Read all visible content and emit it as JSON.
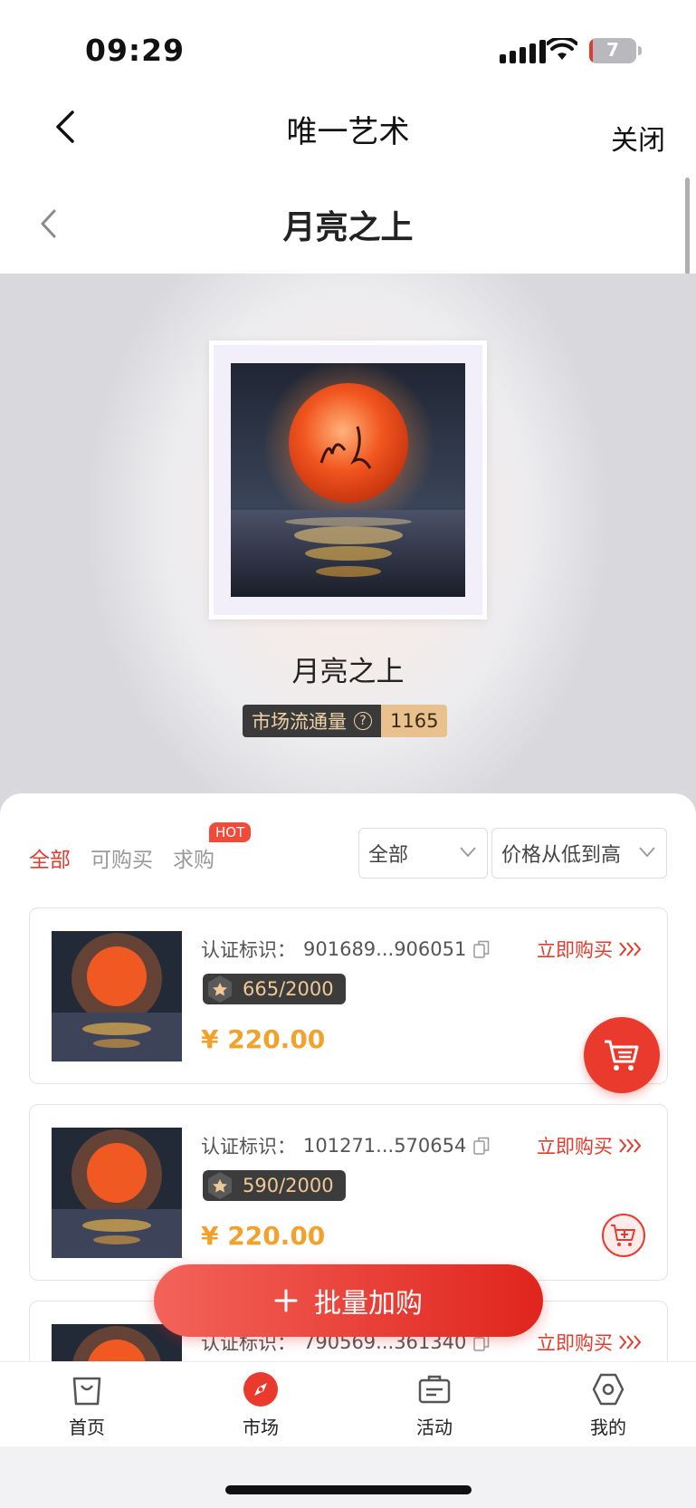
{
  "status_bar": {
    "time": "09:29",
    "battery": "7"
  },
  "app_header": {
    "title": "唯一艺术",
    "close_label": "关闭"
  },
  "page_header": {
    "title": "月亮之上"
  },
  "hero": {
    "title": "月亮之上",
    "circulation_label": "市场流通量",
    "circulation_value": "1165"
  },
  "filters": {
    "tabs": [
      {
        "label": "全部",
        "active": true
      },
      {
        "label": "可购买",
        "active": false
      },
      {
        "label": "求购",
        "active": false
      }
    ],
    "hot_badge": "HOT",
    "dropdown_category": "全部",
    "dropdown_sort": "价格从低到高"
  },
  "listings": [
    {
      "cert_label": "认证标识：",
      "cert_id": "901689...906051",
      "buy_label": "立即购买",
      "serial": "665/2000",
      "price": "¥ 220.00"
    },
    {
      "cert_label": "认证标识：",
      "cert_id": "101271...570654",
      "buy_label": "立即购买",
      "serial": "590/2000",
      "price": "¥ 220.00"
    },
    {
      "cert_label": "认证标识：",
      "cert_id": "790569...361340",
      "buy_label": "立即购买",
      "serial": "",
      "price": ""
    }
  ],
  "bulk_button": {
    "label": "批量加购"
  },
  "tabbar": {
    "items": [
      {
        "label": "首页",
        "icon": "shopping-bag-icon"
      },
      {
        "label": "市场",
        "icon": "compass-icon"
      },
      {
        "label": "活动",
        "icon": "ticket-icon"
      },
      {
        "label": "我的",
        "icon": "hexagon-icon"
      }
    ]
  },
  "colors": {
    "accent": "#e43b2c",
    "price": "#f2a12b",
    "badge_dark": "#3a3a3a",
    "badge_gold": "#e8c18e"
  }
}
